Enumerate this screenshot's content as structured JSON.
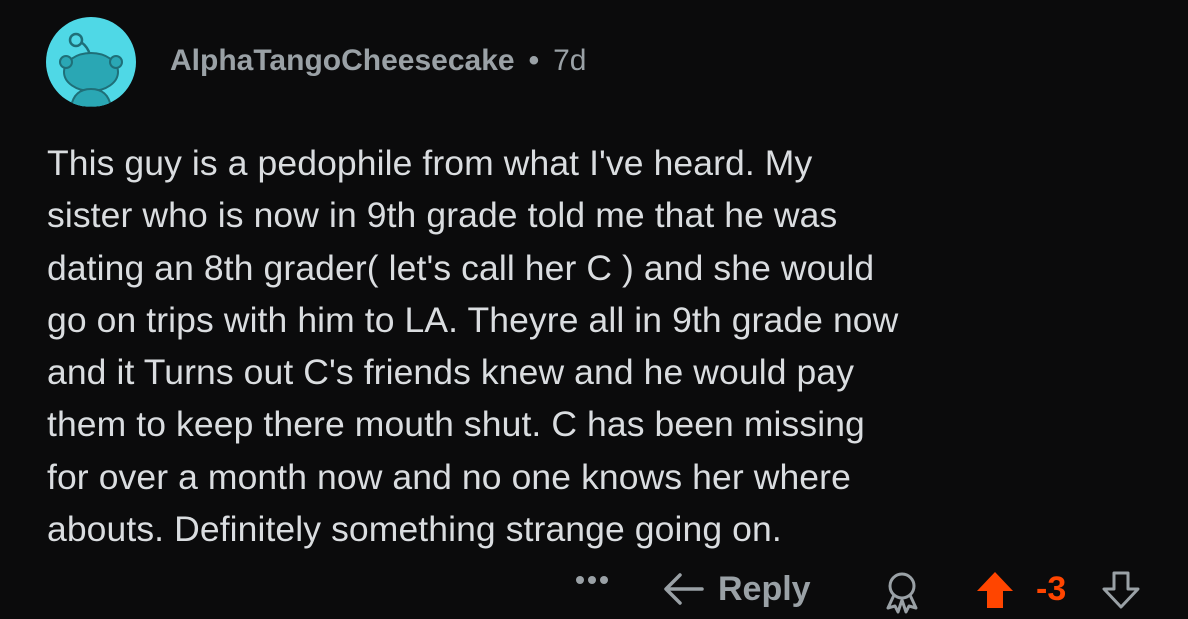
{
  "comment": {
    "username": "AlphaTangoCheesecake",
    "separator": "•",
    "age": "7d",
    "lines": [
      "This guy is a pedophile from what I've heard. My",
      "sister who is now in 9th grade told me that he was",
      "dating an 8th grader( let's call her C ) and she would",
      "go on trips with him to LA. Theyre all in 9th grade now",
      "and it Turns out C's friends knew and he would pay",
      "them to keep there mouth shut. C has been missing",
      "for over a month now and no one knows her where",
      "abouts. Definitely something strange going on."
    ]
  },
  "actions": {
    "more_icon": "more-options-icon",
    "more_glyph": "•••",
    "reply_icon": "reply-arrow-icon",
    "reply_label": "Reply",
    "award_icon": "award-icon",
    "upvote_icon": "upvote-arrow-icon",
    "score": "-3",
    "downvote_icon": "downvote-arrow-icon"
  },
  "colors": {
    "background": "#0b0b0c",
    "text": "#dadde0",
    "meta": "#9aa1a6",
    "avatar": "#4fd8e6",
    "upvote": "#ff4500"
  }
}
